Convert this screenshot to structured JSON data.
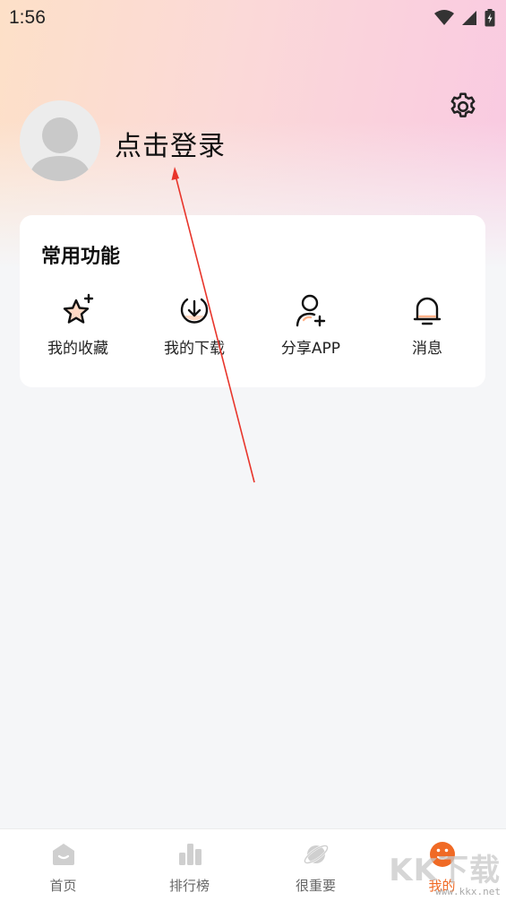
{
  "status_bar": {
    "time": "1:56"
  },
  "profile": {
    "login_text": "点击登录"
  },
  "common_functions": {
    "title": "常用功能",
    "items": [
      {
        "label": "我的收藏",
        "icon": "star-icon"
      },
      {
        "label": "我的下载",
        "icon": "download-icon"
      },
      {
        "label": "分享APP",
        "icon": "add-user-icon"
      },
      {
        "label": "消息",
        "icon": "bell-icon"
      }
    ]
  },
  "tabbar": {
    "items": [
      {
        "label": "首页",
        "icon": "home-icon"
      },
      {
        "label": "排行榜",
        "icon": "ranking-icon"
      },
      {
        "label": "很重要",
        "icon": "planet-icon"
      },
      {
        "label": "我的",
        "icon": "profile-face-icon",
        "active": true
      }
    ]
  },
  "watermark": {
    "text": "KK下载",
    "url": "www.kkx.net"
  },
  "colors": {
    "accent": "#f06a25",
    "background": "#f5f6f8",
    "annotation": "#e8352b"
  }
}
